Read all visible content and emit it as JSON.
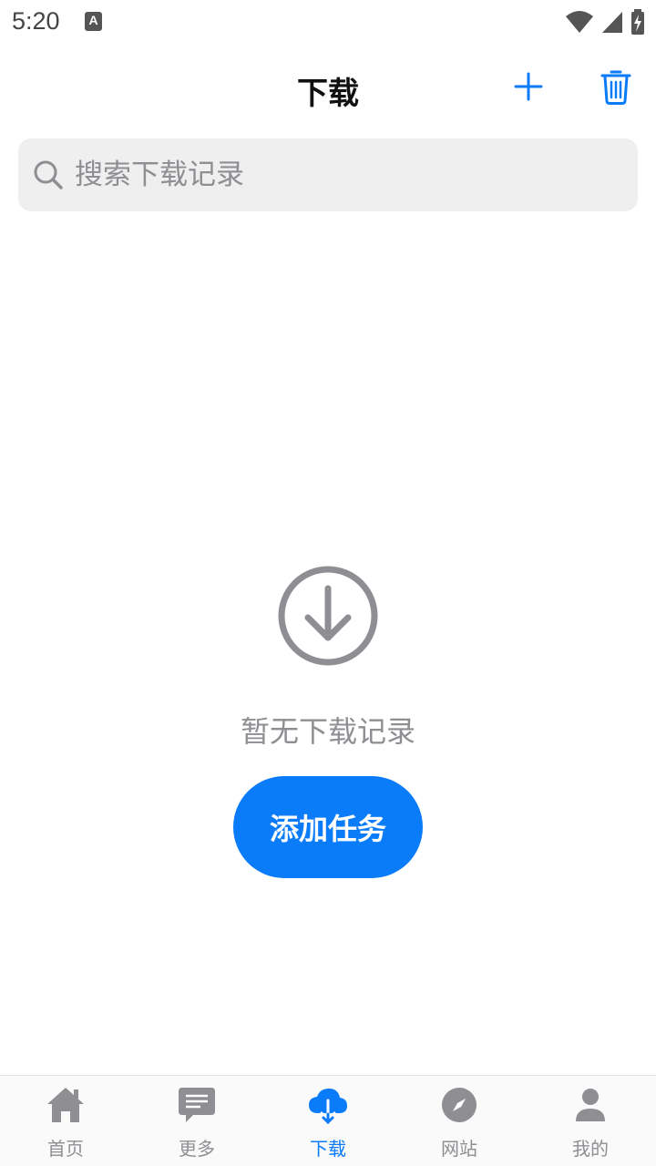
{
  "status_bar": {
    "time": "5:20",
    "notification_icon": "A",
    "icons": [
      "wifi-icon",
      "signal-icon",
      "battery-charging-icon"
    ]
  },
  "header": {
    "title": "下载",
    "add_icon": "plus-icon",
    "delete_icon": "trash-icon"
  },
  "search": {
    "placeholder": "搜索下载记录",
    "value": ""
  },
  "empty_state": {
    "icon": "download-circle-icon",
    "message": "暂无下载记录",
    "button_label": "添加任务"
  },
  "tabbar": {
    "active": "下载",
    "items": [
      {
        "label": "首页",
        "icon": "home-icon"
      },
      {
        "label": "更多",
        "icon": "message-icon"
      },
      {
        "label": "下载",
        "icon": "cloud-download-icon"
      },
      {
        "label": "网站",
        "icon": "compass-icon"
      },
      {
        "label": "我的",
        "icon": "person-icon"
      }
    ]
  },
  "colors": {
    "accent": "#0a7cf9",
    "muted": "#8e8e93",
    "search_bg": "#efefef"
  }
}
